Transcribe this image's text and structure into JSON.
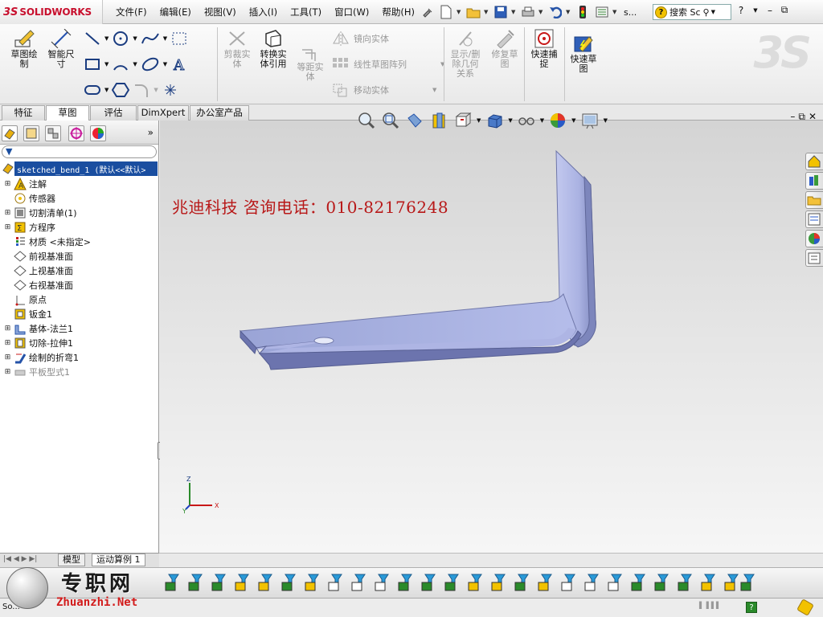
{
  "app": {
    "brand_ds": "3S",
    "brand_name": "SOLIDWORKS"
  },
  "menu": [
    "文件(F)",
    "编辑(E)",
    "视图(V)",
    "插入(I)",
    "工具(T)",
    "窗口(W)",
    "帮助(H)"
  ],
  "quick_access": {
    "more_label": "s..."
  },
  "search": {
    "placeholder": "搜索 Sc"
  },
  "window_controls": {
    "help": "?",
    "minimize": "–",
    "restore": "⧉"
  },
  "commands": {
    "sketch": "草图绘\n制",
    "smart_dim": "智能尺\n寸",
    "trim": "剪裁实\n体",
    "convert": "转换实\n体引用",
    "offset": "等距实\n体",
    "mirror": "镜向实体",
    "linear_pattern": "线性草图阵列",
    "move": "移动实体",
    "display_delete": "显示/删\n除几何\n关系",
    "repair": "修复草\n图",
    "quick_snap": "快速捕\n捉",
    "rapid_sketch": "快速草\n图"
  },
  "tabs": [
    "特征",
    "草图",
    "评估",
    "DimXpert",
    "办公室产品"
  ],
  "active_tab": 1,
  "tree": {
    "root": "sketched_bend_1  (默认<<默认>",
    "items": [
      {
        "label": "注解",
        "expand": true,
        "icon": "annotations"
      },
      {
        "label": "传感器",
        "expand": false,
        "icon": "sensor"
      },
      {
        "label": "切割清单(1)",
        "expand": true,
        "icon": "cutlist"
      },
      {
        "label": "方程序",
        "expand": true,
        "icon": "equation"
      },
      {
        "label": "材质 <未指定>",
        "expand": false,
        "icon": "material"
      },
      {
        "label": "前视基准面",
        "expand": false,
        "icon": "plane"
      },
      {
        "label": "上视基准面",
        "expand": false,
        "icon": "plane"
      },
      {
        "label": "右视基准面",
        "expand": false,
        "icon": "plane"
      },
      {
        "label": "原点",
        "expand": false,
        "icon": "origin"
      },
      {
        "label": "钣金1",
        "expand": false,
        "icon": "sheetmetal"
      },
      {
        "label": "基体-法兰1",
        "expand": true,
        "icon": "baseflange"
      },
      {
        "label": "切除-拉伸1",
        "expand": true,
        "icon": "cutextrude"
      },
      {
        "label": "绘制的折弯1",
        "expand": true,
        "icon": "sketchedbend"
      },
      {
        "label": "平板型式1",
        "expand": true,
        "icon": "flatpattern",
        "grey": true
      }
    ]
  },
  "watermark": "兆迪科技    咨询电话：010-82176248",
  "bottom_tabs": [
    "模型",
    "运动算例 1"
  ],
  "status": {
    "left": "So...",
    "brand_cn": "专职网",
    "brand_en": "Zhuanzhi.Net",
    "help_badge": "?"
  },
  "triad": {
    "x": "X",
    "y": "Y",
    "z": "Z"
  }
}
